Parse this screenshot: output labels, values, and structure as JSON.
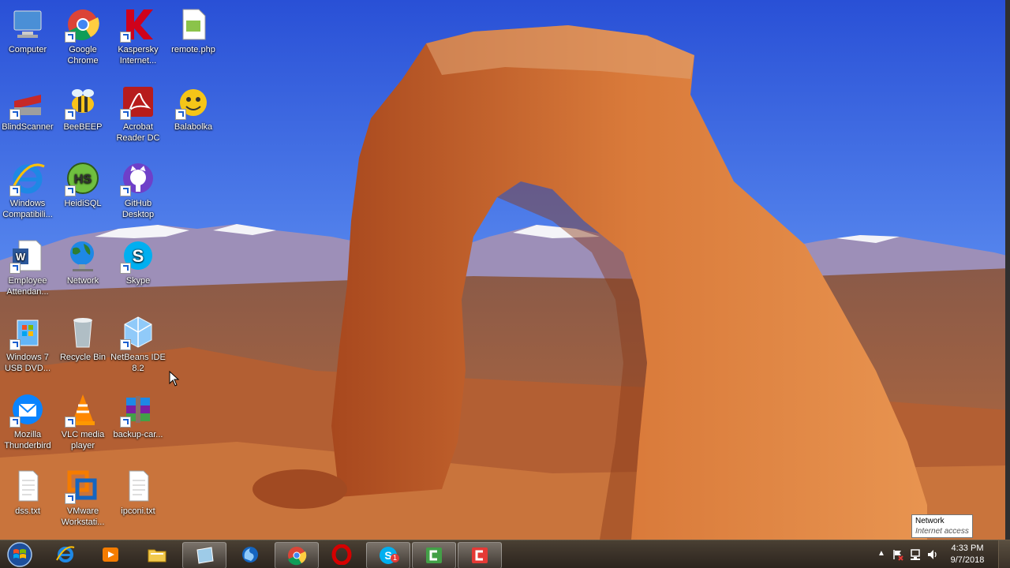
{
  "desktop": {
    "icons": [
      {
        "label": "Computer",
        "icon": "computer-icon",
        "color": "#4a8fd6"
      },
      {
        "label": "Google Chrome",
        "icon": "chrome-icon",
        "color": "#db4437"
      },
      {
        "label": "Kaspersky Internet...",
        "icon": "kaspersky-icon",
        "color": "#d0021b"
      },
      {
        "label": "remote.php",
        "icon": "php-file-icon",
        "color": "#8bc34a"
      },
      {
        "label": "BlindScanner",
        "icon": "scanner-icon",
        "color": "#c62828"
      },
      {
        "label": "BeeBEEP",
        "icon": "bee-icon",
        "color": "#f9c31a"
      },
      {
        "label": "Acrobat Reader DC",
        "icon": "acrobat-icon",
        "color": "#b71c1c"
      },
      {
        "label": "Balabolka",
        "icon": "balabolka-icon",
        "color": "#f5c518"
      },
      {
        "label": "Windows Compatibili...",
        "icon": "ie-icon",
        "color": "#1e88e5"
      },
      {
        "label": "HeidiSQL",
        "icon": "heidisql-icon",
        "color": "#6fbf3f"
      },
      {
        "label": "GitHub Desktop",
        "icon": "github-icon",
        "color": "#6e40c9"
      },
      {
        "label": "Employee Attendan...",
        "icon": "word-doc-icon",
        "color": "#2b579a"
      },
      {
        "label": "Network",
        "icon": "network-globe-icon",
        "color": "#2e7d32"
      },
      {
        "label": "Skype",
        "icon": "skype-icon",
        "color": "#00aff0"
      },
      {
        "label": "Windows 7 USB DVD...",
        "icon": "windows-usb-icon",
        "color": "#64b5f6"
      },
      {
        "label": "Recycle Bin",
        "icon": "recycle-bin-icon",
        "color": "#b0bec5"
      },
      {
        "label": "NetBeans IDE 8.2",
        "icon": "netbeans-icon",
        "color": "#90caf9"
      },
      {
        "label": "Mozilla Thunderbird",
        "icon": "thunderbird-icon",
        "color": "#0a84ff"
      },
      {
        "label": "VLC media player",
        "icon": "vlc-icon",
        "color": "#ff8800"
      },
      {
        "label": "backup-car...",
        "icon": "winrar-icon",
        "color": "#7b1fa2"
      },
      {
        "label": "dss.txt",
        "icon": "text-file-icon",
        "color": "#ffffff"
      },
      {
        "label": "VMware Workstati...",
        "icon": "vmware-icon",
        "color": "#f57c00"
      },
      {
        "label": "ipconi.txt",
        "icon": "text-file-icon",
        "color": "#ffffff"
      }
    ]
  },
  "taskbar": {
    "start_icon": "windows-start-icon",
    "items": [
      {
        "icon": "ie-taskbar-icon",
        "active": false,
        "color": "#1e88e5"
      },
      {
        "icon": "media-player-icon",
        "active": false,
        "color": "#f57c00"
      },
      {
        "icon": "explorer-folder-icon",
        "active": false,
        "color": "#f2c94c"
      },
      {
        "icon": "window-app-icon",
        "active": true,
        "color": "#9ecbe8"
      },
      {
        "icon": "firefox-like-icon",
        "active": false,
        "color": "#1565c0"
      },
      {
        "icon": "chrome-taskbar-icon",
        "active": true,
        "color": "#db4437"
      },
      {
        "icon": "opera-icon",
        "active": false,
        "color": "#d50000"
      },
      {
        "icon": "skype-taskbar-icon",
        "active": true,
        "color": "#00aff0",
        "badge": "1"
      },
      {
        "icon": "camtasia-green-icon",
        "active": true,
        "color": "#43a047"
      },
      {
        "icon": "camtasia-red-icon",
        "active": true,
        "color": "#e53935"
      }
    ],
    "clock": {
      "time": "4:33 PM",
      "date": "9/7/2018"
    }
  },
  "network_tooltip": {
    "title": "Network",
    "status": "Internet access"
  },
  "colors": {
    "sky_top": "#2c58d8",
    "sky_bottom": "#7aa6f2",
    "rock": "#c8662e",
    "taskbar": "#3a3128"
  }
}
